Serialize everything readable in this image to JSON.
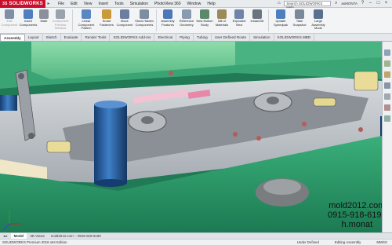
{
  "app": {
    "logo_text": "SOLIDWORKS",
    "logo_mark": "3S"
  },
  "menu": [
    "File",
    "Edit",
    "View",
    "Insert",
    "Tools",
    "Simulation",
    "PhotoView 360",
    "Window",
    "Help"
  ],
  "search": {
    "placeholder": "Search SOLIDWORKS Help",
    "user": "asMONTA"
  },
  "ribbon": [
    {
      "label": "Edit Component",
      "color": "#7e8fa6",
      "dim": true
    },
    {
      "label": "Insert Components",
      "color": "#4f7fbf",
      "dim": false
    },
    {
      "label": "Mate",
      "color": "#8a8f99",
      "dim": false
    },
    {
      "label": "Component Preview Window",
      "color": "#9aa3ad",
      "dim": true
    },
    {
      "label": "Linear Component Pattern",
      "color": "#5a86c4",
      "dim": false
    },
    {
      "label": "Smart Fasteners",
      "color": "#c89a3a",
      "dim": false
    },
    {
      "label": "Move Component",
      "color": "#6d7fa0",
      "dim": false
    },
    {
      "label": "Show Hidden Components",
      "color": "#7d8ea3",
      "dim": false
    },
    {
      "label": "Assembly Features",
      "color": "#4a78b8",
      "dim": false
    },
    {
      "label": "Reference Geometry",
      "color": "#8a9bb0",
      "dim": false
    },
    {
      "label": "New Motion Study",
      "color": "#5a8a6a",
      "dim": false
    },
    {
      "label": "Bill of Materials",
      "color": "#9b8b5a",
      "dim": false
    },
    {
      "label": "Exploded View",
      "color": "#6f84a8",
      "dim": false
    },
    {
      "label": "Instant3D",
      "color": "#6a7380",
      "dim": false
    },
    {
      "label": "Update Speedpak",
      "color": "#4d7fbf",
      "dim": false
    },
    {
      "label": "Take Snapshot",
      "color": "#7a8899",
      "dim": false
    },
    {
      "label": "Large Assembly Mode",
      "color": "#5b6f8f",
      "dim": false
    }
  ],
  "tabs": [
    "Assembly",
    "Layout",
    "Sketch",
    "Evaluate",
    "Render Tools",
    "SOLIDWORKS Add-Ins",
    "Electrical",
    "Piping",
    "Tubing",
    "User Defined Route",
    "Simulation",
    "SOLIDWORKS MBD"
  ],
  "active_tab": "Assembly",
  "watermark": {
    "line1": "mold2012.com",
    "line2": "0915-918-6190",
    "line3": "h.monat"
  },
  "bottom_tabs": [
    "Model",
    "3D Views",
    "mold2012.com -- 0915-918-6190"
  ],
  "status": {
    "left": "SOLIDWORKS Premium 2018 x64 Edition",
    "under_defined": "Under Defined",
    "editing": "Editing Assembly",
    "units": "MMGS"
  },
  "colors": {
    "accent": "#c8102e",
    "mold_green": "#2e9d6d",
    "plate_gray": "#bfc4c9",
    "blue_pin": "#1e4f8f"
  }
}
